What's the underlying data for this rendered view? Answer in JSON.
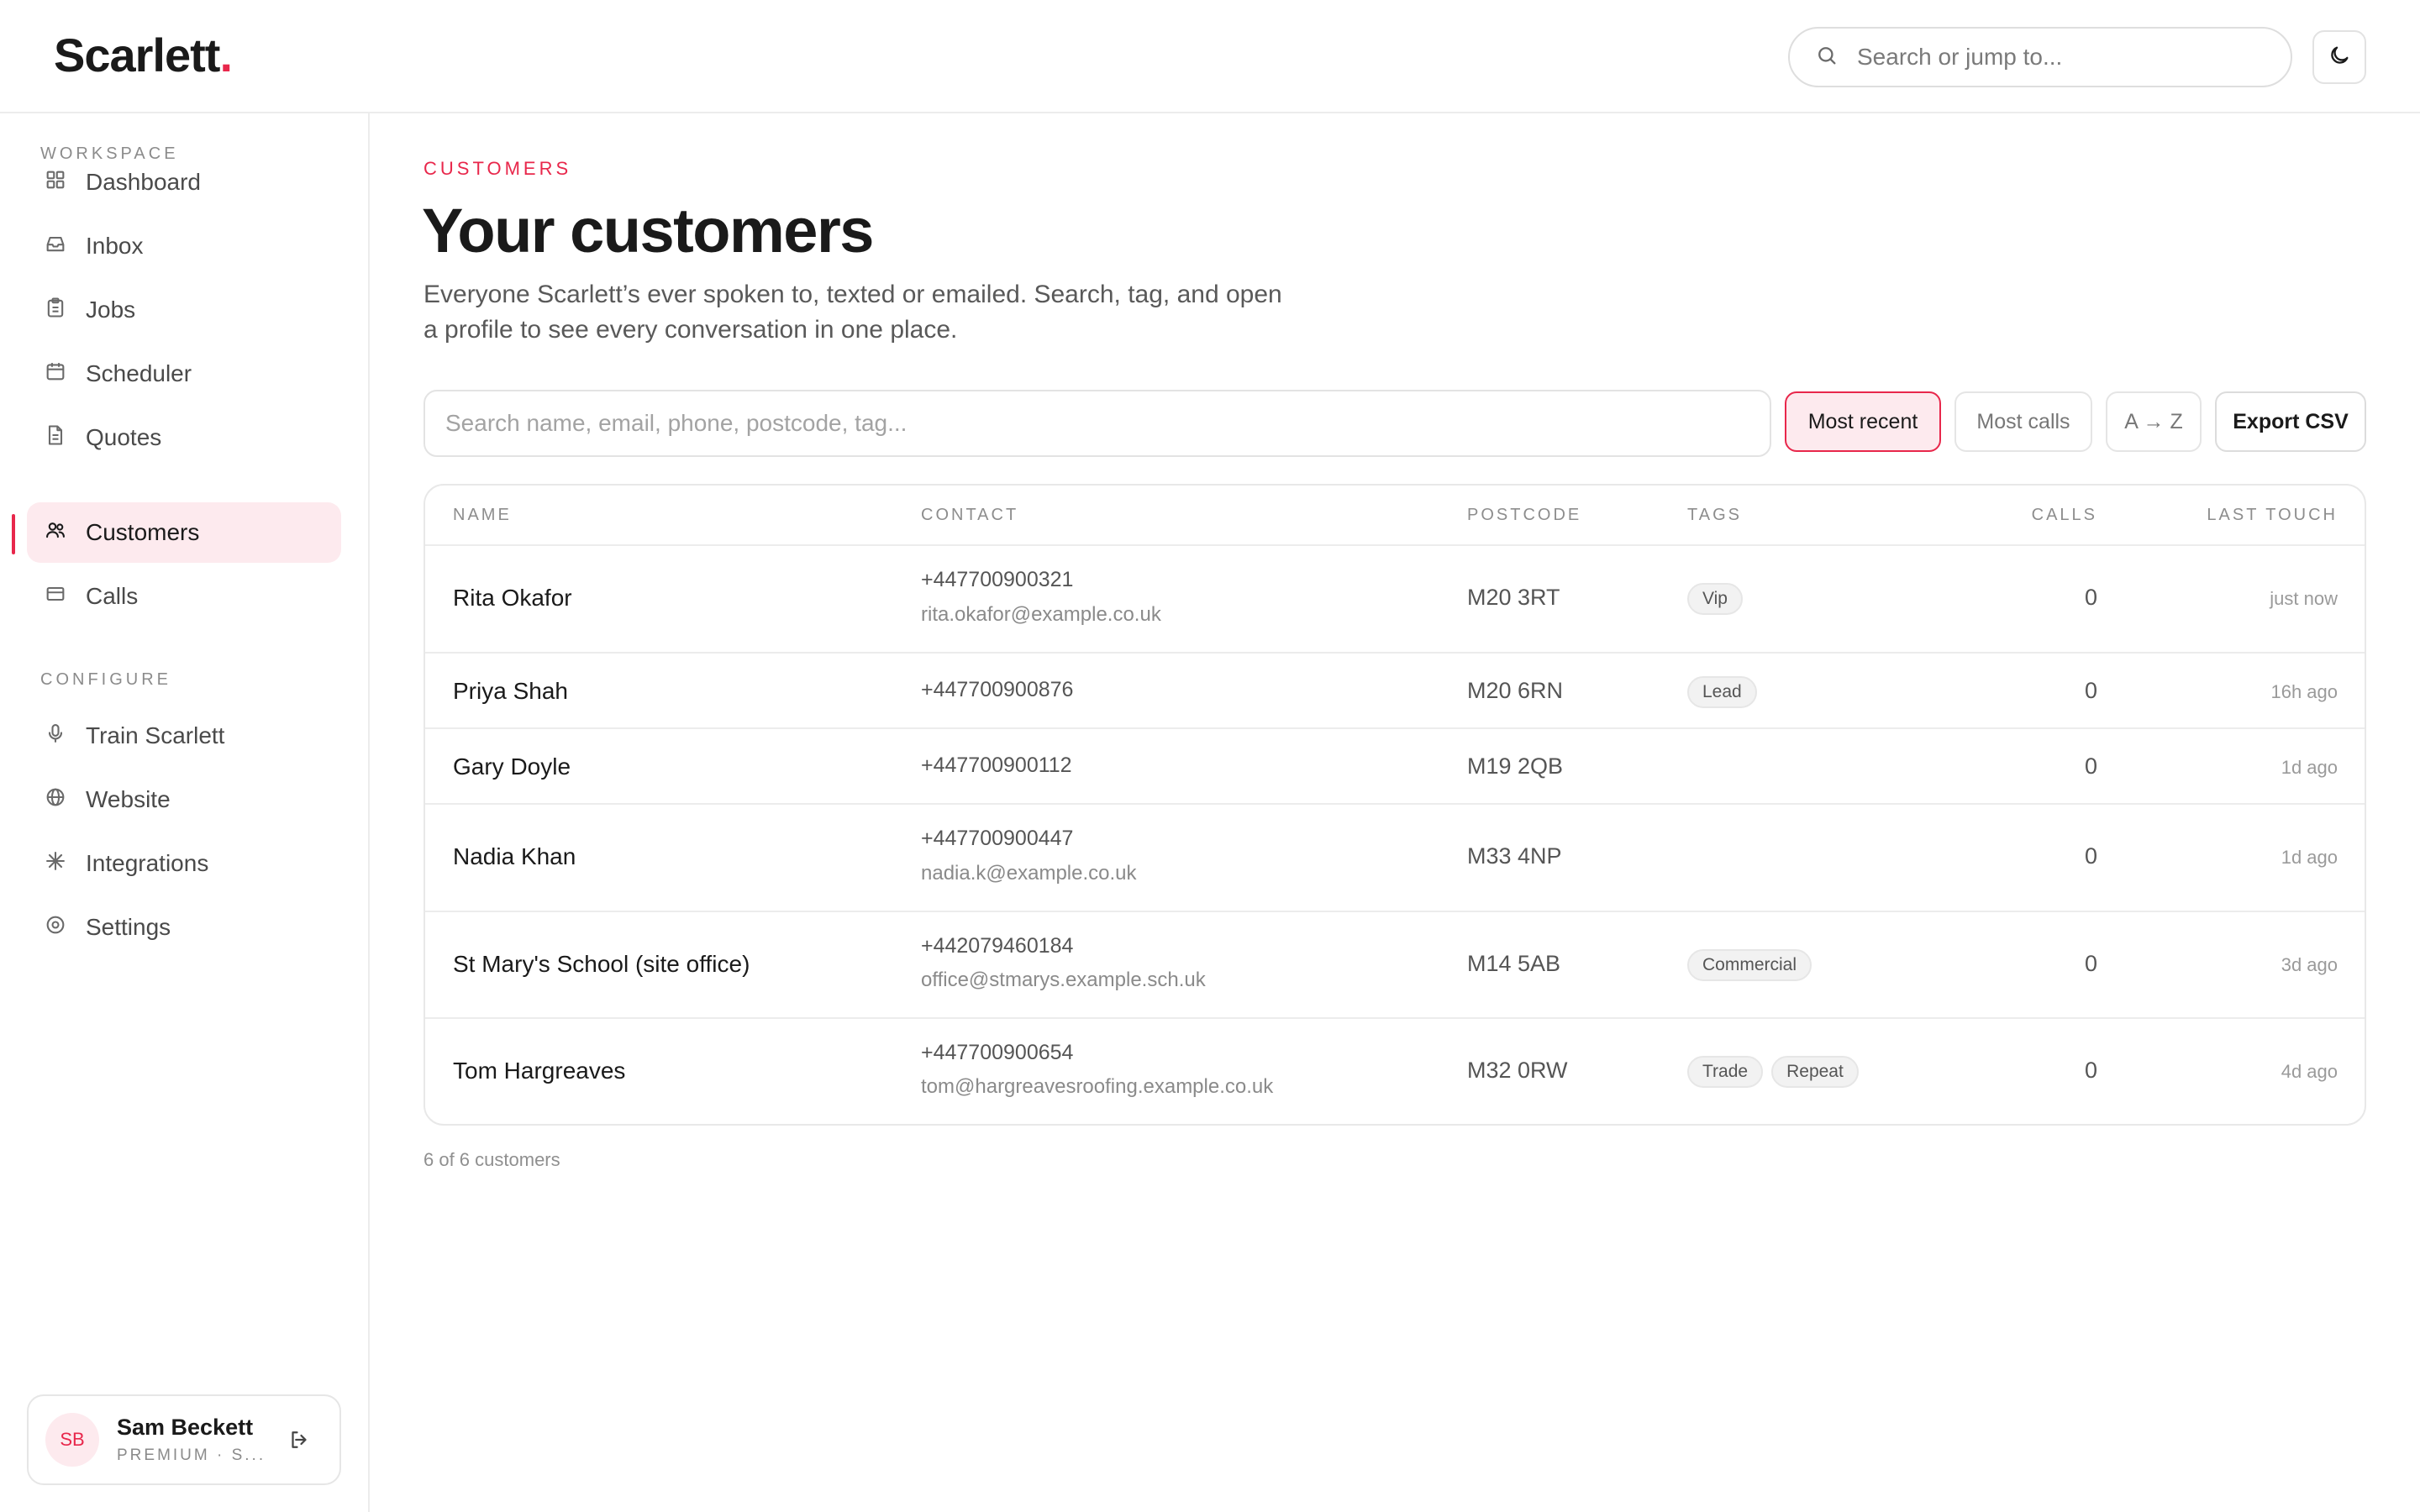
{
  "app": {
    "logo_text": "Scarlett",
    "logo_dot": ".",
    "accent_color": "#e8274b"
  },
  "header": {
    "search_placeholder": "Search or jump to...",
    "search_icon": "search-icon",
    "theme_icon": "moon-icon"
  },
  "sidebar": {
    "workspace_label": "WORKSPACE",
    "configure_label": "CONFIGURE",
    "workspace_items": [
      {
        "label": "Dashboard",
        "icon": "grid-icon"
      },
      {
        "label": "Inbox",
        "icon": "inbox-icon"
      },
      {
        "label": "Jobs",
        "icon": "clipboard-icon"
      },
      {
        "label": "Scheduler",
        "icon": "calendar-icon"
      },
      {
        "label": "Quotes",
        "icon": "document-icon"
      },
      {
        "label": "Customers",
        "icon": "users-icon",
        "active": true
      },
      {
        "label": "Calls",
        "icon": "card-icon"
      }
    ],
    "configure_items": [
      {
        "label": "Train Scarlett",
        "icon": "microphone-icon"
      },
      {
        "label": "Website",
        "icon": "globe-icon"
      },
      {
        "label": "Integrations",
        "icon": "sparkle-icon"
      },
      {
        "label": "Settings",
        "icon": "settings-icon"
      }
    ],
    "user": {
      "initials": "SB",
      "name": "Sam Beckett",
      "plan": "PREMIUM · S...",
      "logout_icon": "logout-icon"
    }
  },
  "main": {
    "eyebrow": "CUSTOMERS",
    "title": "Your customers",
    "description": "Everyone Scarlett’s ever spoken to, texted or emailed. Search, tag, and open a profile to see every conversation in one place.",
    "filter_placeholder": "Search name, email, phone, postcode, tag...",
    "sort_options": [
      {
        "label": "Most recent",
        "active": true
      },
      {
        "label": "Most calls",
        "active": false
      },
      {
        "label": "A → Z",
        "active": false
      }
    ],
    "export_label": "Export CSV",
    "table": {
      "columns": [
        "NAME",
        "CONTACT",
        "POSTCODE",
        "TAGS",
        "CALLS",
        "LAST TOUCH"
      ],
      "rows": [
        {
          "name": "Rita Okafor",
          "phone": "+447700900321",
          "email": "rita.okafor@example.co.uk",
          "postcode": "M20 3RT",
          "tags": [
            "Vip"
          ],
          "calls": "0",
          "last_touch": "just now"
        },
        {
          "name": "Priya Shah",
          "phone": "+447700900876",
          "email": "",
          "postcode": "M20 6RN",
          "tags": [
            "Lead"
          ],
          "calls": "0",
          "last_touch": "16h ago"
        },
        {
          "name": "Gary Doyle",
          "phone": "+447700900112",
          "email": "",
          "postcode": "M19 2QB",
          "tags": [],
          "calls": "0",
          "last_touch": "1d ago"
        },
        {
          "name": "Nadia Khan",
          "phone": "+447700900447",
          "email": "nadia.k@example.co.uk",
          "postcode": "M33 4NP",
          "tags": [],
          "calls": "0",
          "last_touch": "1d ago"
        },
        {
          "name": "St Mary's School (site office)",
          "phone": "+442079460184",
          "email": "office@stmarys.example.sch.uk",
          "postcode": "M14 5AB",
          "tags": [
            "Commercial"
          ],
          "calls": "0",
          "last_touch": "3d ago"
        },
        {
          "name": "Tom Hargreaves",
          "phone": "+447700900654",
          "email": "tom@hargreavesroofing.example.co.uk",
          "postcode": "M32 0RW",
          "tags": [
            "Trade",
            "Repeat"
          ],
          "calls": "0",
          "last_touch": "4d ago"
        }
      ]
    },
    "count_text": "6 of 6 customers"
  }
}
